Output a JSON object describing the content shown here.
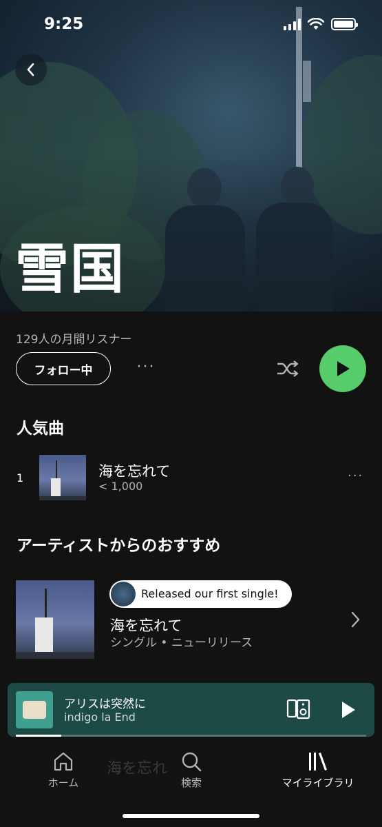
{
  "status": {
    "time": "9:25"
  },
  "artist": {
    "name": "雪国",
    "monthly_listeners": "129人の月間リスナー",
    "follow_label": "フォロー中",
    "more": "···"
  },
  "popular": {
    "heading": "人気曲",
    "tracks": [
      {
        "rank": "1",
        "title": "海を忘れて",
        "plays": "< 1,000"
      }
    ]
  },
  "recommendation": {
    "heading": "アーティストからのおすすめ",
    "bubble": "Released our first single!",
    "title": "海を忘れて",
    "subtitle": "シングル • ニューリリース"
  },
  "now_playing": {
    "song": "アリスは突然に",
    "artist": "indigo la End",
    "progress": 0.13
  },
  "tabs": {
    "home": "ホーム",
    "search": "検索",
    "library": "マイライブラリ",
    "ghost_text": "海を忘れ"
  },
  "colors": {
    "accent": "#57cc6b",
    "mini_player": "#1d4a44",
    "background": "#121212"
  }
}
